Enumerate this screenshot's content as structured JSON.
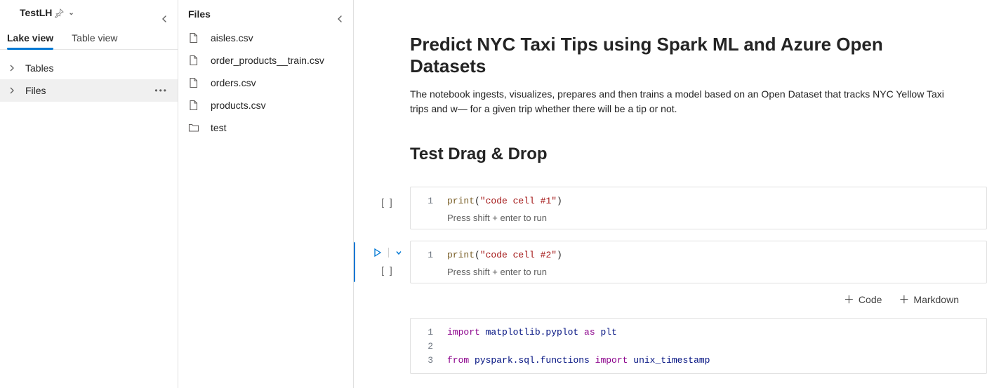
{
  "sidebar": {
    "title": "TestLH",
    "tabs": [
      {
        "label": "Lake view",
        "active": true
      },
      {
        "label": "Table view",
        "active": false
      }
    ],
    "tree": [
      {
        "label": "Tables",
        "expanded": false,
        "selected": false
      },
      {
        "label": "Files",
        "expanded": false,
        "selected": true
      }
    ]
  },
  "files_panel": {
    "title": "Files",
    "items": [
      {
        "name": "aisles.csv",
        "type": "file"
      },
      {
        "name": "order_products__train.csv",
        "type": "file"
      },
      {
        "name": "orders.csv",
        "type": "file"
      },
      {
        "name": "products.csv",
        "type": "file"
      },
      {
        "name": "test",
        "type": "folder"
      }
    ]
  },
  "notebook": {
    "title": "Predict NYC Taxi Tips using Spark ML and Azure Open Datasets",
    "description": "The notebook ingests, visualizes, prepares and then trains a model based on an Open Dataset that tracks NYC Yellow Taxi trips and w— for a given trip whether there will be a tip or not.",
    "subheading": "Test Drag & Drop",
    "run_hint": "Press shift + enter to run",
    "cells": [
      {
        "active": false,
        "exec_label": "[ ]",
        "lines": [
          {
            "ln": "1",
            "tokens": [
              {
                "t": "print",
                "c": "tok-fn"
              },
              {
                "t": "(",
                "c": ""
              },
              {
                "t": "\"code cell #1\"",
                "c": "tok-str"
              },
              {
                "t": ")",
                "c": ""
              }
            ]
          }
        ]
      },
      {
        "active": true,
        "exec_label": "[ ]",
        "lines": [
          {
            "ln": "1",
            "tokens": [
              {
                "t": "print",
                "c": "tok-fn"
              },
              {
                "t": "(",
                "c": ""
              },
              {
                "t": "\"code cell #2\"",
                "c": "tok-str"
              },
              {
                "t": ")",
                "c": ""
              }
            ]
          }
        ]
      },
      {
        "active": false,
        "exec_label": "",
        "lines": [
          {
            "ln": "1",
            "tokens": [
              {
                "t": "import",
                "c": "tok-kw"
              },
              {
                "t": " matplotlib.pyplot ",
                "c": "tok-id"
              },
              {
                "t": "as",
                "c": "tok-kw"
              },
              {
                "t": " plt",
                "c": "tok-id"
              }
            ]
          },
          {
            "ln": "2",
            "tokens": []
          },
          {
            "ln": "3",
            "tokens": [
              {
                "t": "from",
                "c": "tok-kw"
              },
              {
                "t": " pyspark.sql.functions ",
                "c": "tok-id"
              },
              {
                "t": "import",
                "c": "tok-kw"
              },
              {
                "t": " unix_timestamp",
                "c": "tok-id"
              }
            ]
          }
        ]
      }
    ],
    "insert": {
      "code_label": "Code",
      "markdown_label": "Markdown"
    }
  }
}
